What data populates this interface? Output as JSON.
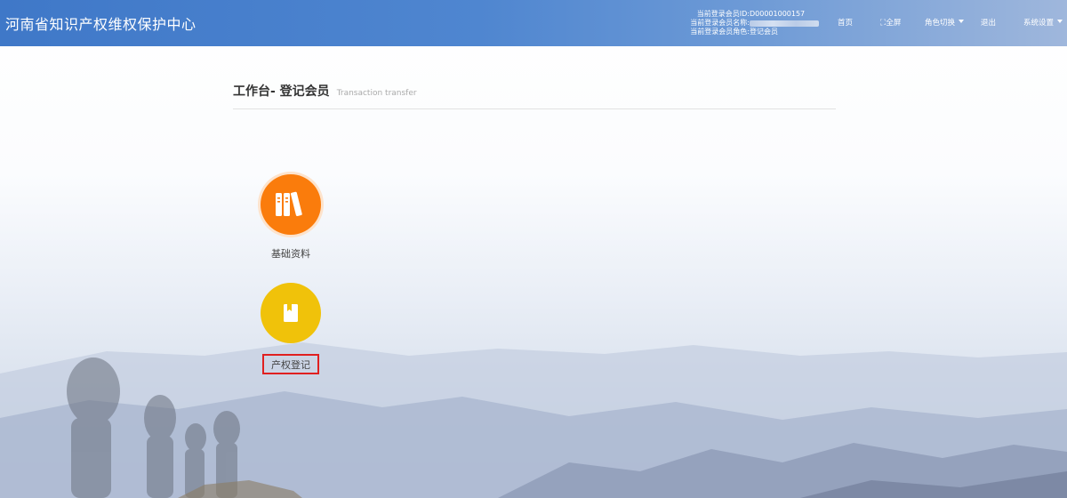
{
  "header": {
    "title": "河南省知识产权维权保护中心",
    "login": {
      "id_label": "当前登录会员ID:",
      "id_value": "D00001000157",
      "name_label": "当前登录会员名称:",
      "role_label": "当前登录会员角色:",
      "role_value": "登记会员"
    },
    "nav": {
      "home": "首页",
      "fullscreen_icon": "expand-icon",
      "fullscreen": "全屏",
      "role_switch": "角色切换",
      "logout": "退出",
      "settings": "系统设置"
    }
  },
  "workspace": {
    "title": "工作台- 登记会员",
    "subtitle": "Transaction transfer"
  },
  "tiles": [
    {
      "label": "基础资料",
      "icon": "books-icon",
      "color": "#fa7c0c"
    },
    {
      "label": "产权登记",
      "icon": "register-book-icon",
      "color": "#f0c20a"
    }
  ],
  "colors": {
    "header": "#4a80cc",
    "highlight_border": "#e02020"
  }
}
